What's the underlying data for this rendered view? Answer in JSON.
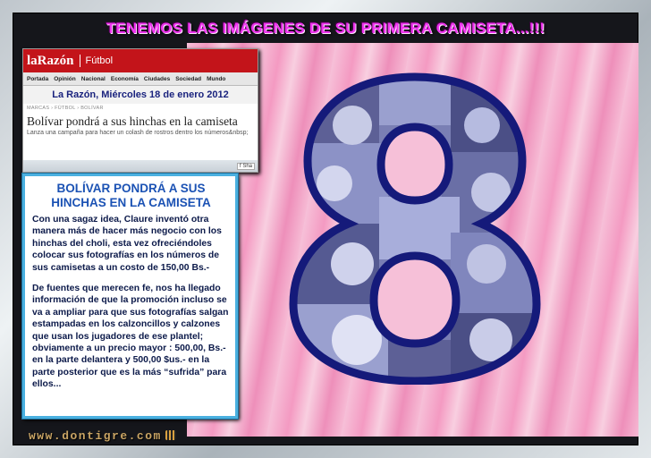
{
  "banner": {
    "text": "TENEMOS LAS IMÁGENES DE SU PRIMERA CAMISETA...!!!"
  },
  "newsclip": {
    "brand": "laRazón",
    "section": "Fútbol",
    "nav": [
      "Portada",
      "Opinión",
      "Nacional",
      "Economía",
      "Ciudades",
      "Sociedad",
      "Mundo"
    ],
    "date": "La Razón, Miércoles 18 de enero 2012",
    "breadcrumb": "MARCAS › FÚTBOL › BOLÍVAR",
    "headline": "Bolívar pondrá a sus hinchas en la camiseta",
    "subheadline": "Lanza una campaña para hacer un colash de rostros dentro los números&nbsp;",
    "share": "f Sha"
  },
  "article": {
    "title": "BOLÍVAR PONDRÁ A SUS HINCHAS EN LA CAMISETA",
    "paragraphs": [
      "Con una sagaz idea, Claure inventó otra manera más de hacer más negocio con los hinchas del choli, esta vez ofreciéndoles colocar sus fotografías en los números de sus camisetas a un costo de 150,00 Bs.-",
      "De fuentes que merecen fe, nos ha llegado información de que la promoción incluso se va a ampliar para que sus fotografías salgan estampadas en los calzoncillos y calzones que usan los jugadores de ese plantel; obviamente a un precio mayor : 500,00, Bs.- en la parte delantera y 500,00  $us.- en la parte posterior que es la más “sufrida” para ellos..."
    ]
  },
  "watermark": {
    "text": "www.dontigre.com"
  },
  "colors": {
    "banner": "#ee33ee",
    "article_title": "#1b52b4",
    "article_border": "#4ab0e0",
    "eight_outline": "#151a7a",
    "shirt_pink": "#f49ac2",
    "newspaper_red": "#c3141a"
  }
}
